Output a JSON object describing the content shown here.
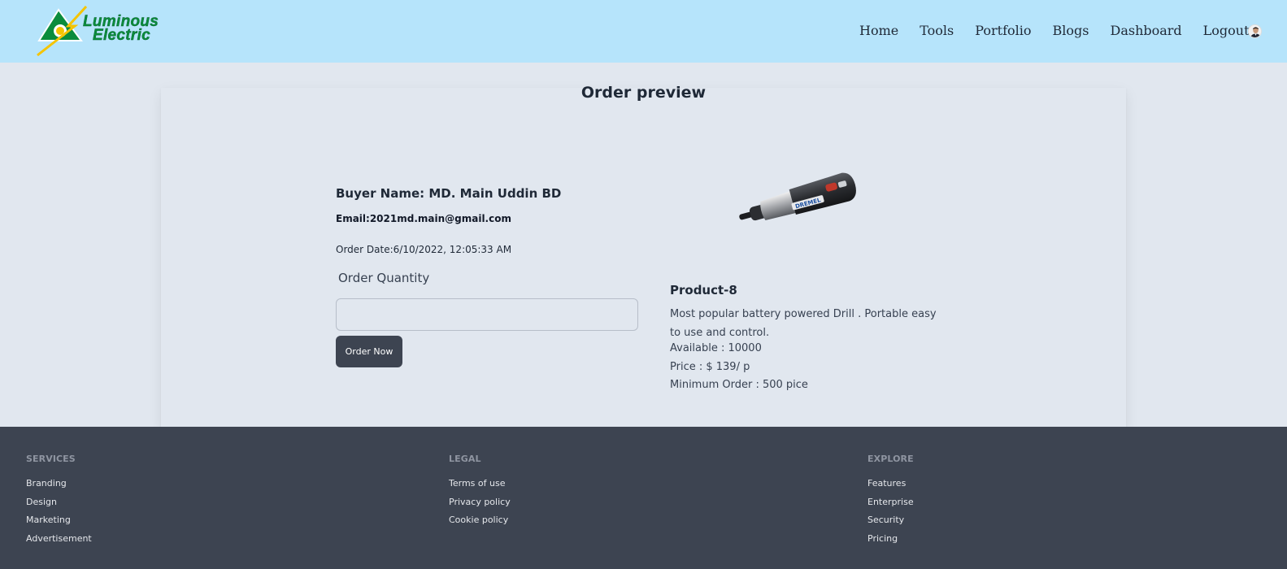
{
  "brand": {
    "name_line1": "Luminous",
    "name_line2": "Electric"
  },
  "nav": {
    "items": [
      "Home",
      "Tools",
      "Portfolio",
      "Blogs",
      "Dashboard",
      "Logout"
    ]
  },
  "page_title": "Order preview",
  "buyer": {
    "name": "Buyer Name: MD. Main Uddin BD",
    "email": "Email:2021md.main@gmail.com",
    "order_date": "Order Date:6/10/2022, 12:05:33 AM"
  },
  "order_form": {
    "quantity_label": "Order Quantity",
    "quantity_value": "",
    "quantity_placeholder": "",
    "submit_label": "Order Now"
  },
  "product": {
    "image_brand_text": "DREMEL",
    "name": "Product-8",
    "description": "Most popular battery powered Drill . Portable easy to use and control.",
    "available": "Available : 10000",
    "price": "Price : $ 139/ p",
    "minimum_order": "Minimum Order : 500 pice"
  },
  "footer": {
    "columns": [
      {
        "title": "SERVICES",
        "links": [
          "Branding",
          "Design",
          "Marketing",
          "Advertisement"
        ]
      },
      {
        "title": "LEGAL",
        "links": [
          "Terms of use",
          "Privacy policy",
          "Cookie policy"
        ]
      },
      {
        "title": "EXPLORE",
        "links": [
          "Features",
          "Enterprise",
          "Security",
          "Pricing"
        ]
      }
    ]
  },
  "colors": {
    "navbar_bg": "#b6e4fb",
    "page_bg": "#e1e7ef",
    "footer_bg": "#3d4451",
    "button_bg": "#3d4451",
    "logo_green": "#0b8c3c",
    "logo_yellow": "#f5c400"
  }
}
